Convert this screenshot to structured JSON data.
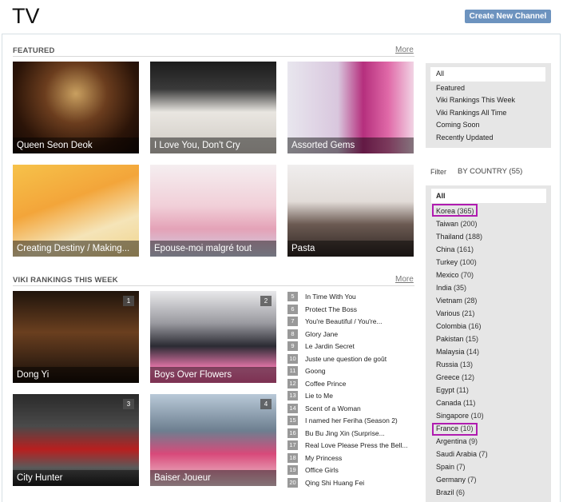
{
  "header": {
    "title": "TV",
    "create_button": "Create New Channel"
  },
  "featured": {
    "heading": "FEATURED",
    "more": "More",
    "items": [
      {
        "title": "Queen Seon Deok"
      },
      {
        "title": "I Love You, Don't Cry"
      },
      {
        "title": "Assorted Gems"
      },
      {
        "title": "Creating Destiny / Making..."
      },
      {
        "title": "Epouse-moi malgré tout"
      },
      {
        "title": "Pasta"
      }
    ]
  },
  "rankings": {
    "heading": "VIKI RANKINGS THIS WEEK",
    "more": "More",
    "top": [
      {
        "rank": "1",
        "title": "Dong Yi"
      },
      {
        "rank": "2",
        "title": "Boys Over Flowers"
      },
      {
        "rank": "3",
        "title": "City Hunter"
      },
      {
        "rank": "4",
        "title": "Baiser Joueur"
      }
    ],
    "list": [
      {
        "rank": "5",
        "title": "In Time With You"
      },
      {
        "rank": "6",
        "title": "Protect The Boss"
      },
      {
        "rank": "7",
        "title": "You're Beautiful / You're..."
      },
      {
        "rank": "8",
        "title": "Glory Jane"
      },
      {
        "rank": "9",
        "title": "Le Jardin Secret"
      },
      {
        "rank": "10",
        "title": "Juste une question de goût"
      },
      {
        "rank": "11",
        "title": "Goong"
      },
      {
        "rank": "12",
        "title": "Coffee Prince"
      },
      {
        "rank": "13",
        "title": "Lie to Me"
      },
      {
        "rank": "14",
        "title": "Scent of a Woman"
      },
      {
        "rank": "15",
        "title": "I named her Feriha (Season 2)"
      },
      {
        "rank": "16",
        "title": "Bu Bu Jing Xin (Surprise..."
      },
      {
        "rank": "17",
        "title": "Real Love Please Press the Bell..."
      },
      {
        "rank": "18",
        "title": "My Princess"
      },
      {
        "rank": "19",
        "title": "Office Girls"
      },
      {
        "rank": "20",
        "title": "Qing Shi Huang Fei"
      }
    ]
  },
  "sidebar": {
    "sort_items": [
      "All",
      "Featured",
      "Viki Rankings This Week",
      "Viki Rankings All Time",
      "Coming Soon",
      "Recently Updated"
    ],
    "filter_label": "Filter",
    "filter_value": "BY COUNTRY (55)",
    "countries": [
      {
        "name": "All",
        "count": ""
      },
      {
        "name": "Korea",
        "count": "(365)"
      },
      {
        "name": "Taiwan",
        "count": "(200)"
      },
      {
        "name": "Thailand",
        "count": "(188)"
      },
      {
        "name": "China",
        "count": "(161)"
      },
      {
        "name": "Turkey",
        "count": "(100)"
      },
      {
        "name": "Mexico",
        "count": "(70)"
      },
      {
        "name": "India",
        "count": "(35)"
      },
      {
        "name": "Vietnam",
        "count": "(28)"
      },
      {
        "name": "Various",
        "count": "(21)"
      },
      {
        "name": "Colombia",
        "count": "(16)"
      },
      {
        "name": "Pakistan",
        "count": "(15)"
      },
      {
        "name": "Malaysia",
        "count": "(14)"
      },
      {
        "name": "Russia",
        "count": "(13)"
      },
      {
        "name": "Greece",
        "count": "(12)"
      },
      {
        "name": "Egypt",
        "count": "(11)"
      },
      {
        "name": "Canada",
        "count": "(11)"
      },
      {
        "name": "Singapore",
        "count": "(10)"
      },
      {
        "name": "France",
        "count": "(10)"
      },
      {
        "name": "Argentina",
        "count": "(9)"
      },
      {
        "name": "Saudi Arabia",
        "count": "(7)"
      },
      {
        "name": "Spain",
        "count": "(7)"
      },
      {
        "name": "Germany",
        "count": "(7)"
      },
      {
        "name": "Brazil",
        "count": "(6)"
      }
    ]
  },
  "colors": {
    "accent": "#6d93bf",
    "highlight": "#b01cb0"
  }
}
